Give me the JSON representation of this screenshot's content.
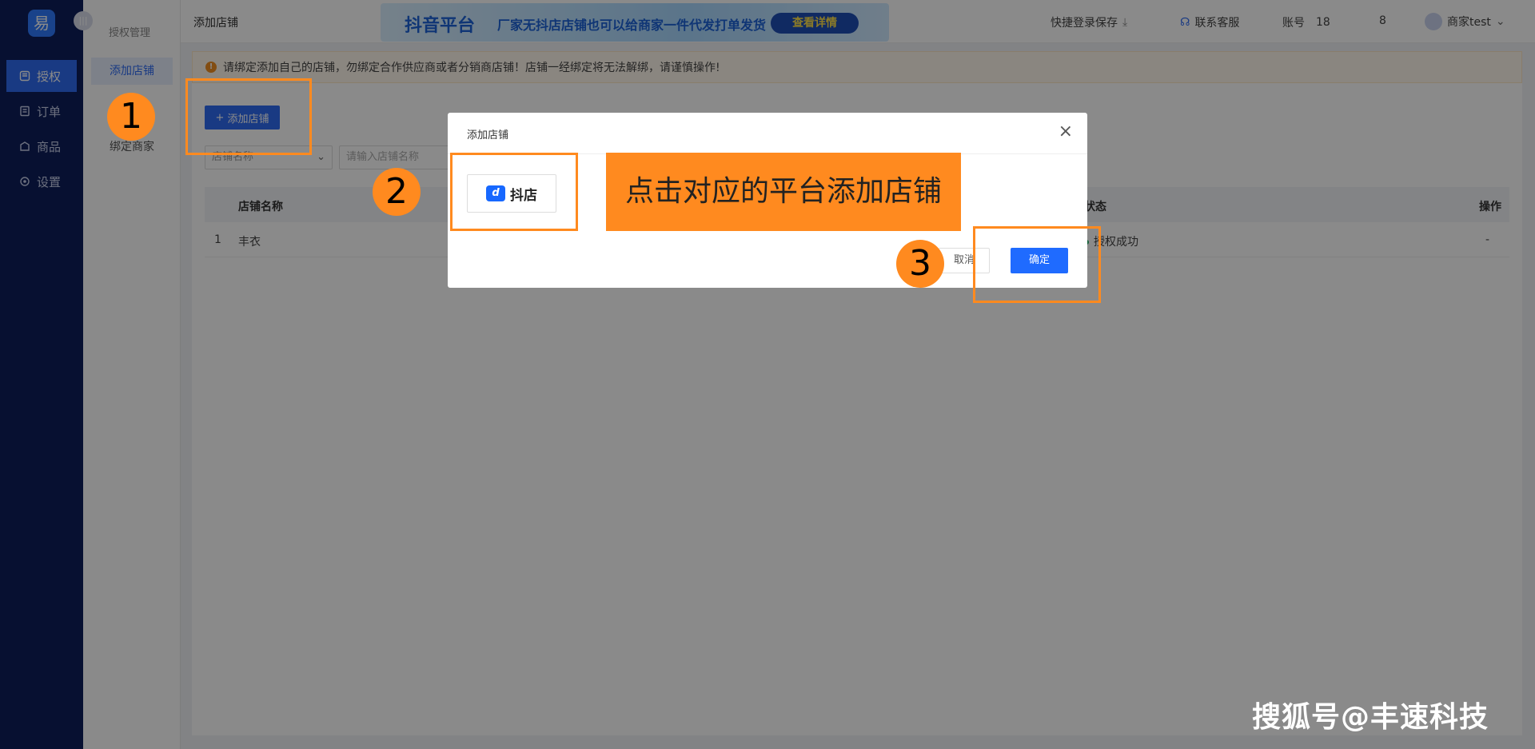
{
  "nav": {
    "logo": "易",
    "items": [
      {
        "label": "授权",
        "icon": "auth-icon",
        "active": true
      },
      {
        "label": "订单",
        "icon": "order-icon",
        "active": false
      },
      {
        "label": "商品",
        "icon": "product-icon",
        "active": false
      },
      {
        "label": "设置",
        "icon": "gear-icon",
        "active": false
      }
    ]
  },
  "subnav": {
    "title": "授权管理",
    "items": [
      {
        "label": "添加店铺",
        "active": true
      },
      {
        "label": "绑定商家",
        "active": false
      }
    ]
  },
  "header": {
    "breadcrumb": "添加店铺",
    "banner": {
      "brand": "抖音平台",
      "text": "厂家无抖店店铺也可以给商家一件代发打单发货",
      "button": "查看详情"
    },
    "quick_login": "快捷登录保存",
    "support": "联系客服",
    "account_label": "账号",
    "account_value": "18",
    "count": "8",
    "user": "商家test"
  },
  "main": {
    "notice": "请绑定添加自己的店铺，勿绑定合作供应商或者分销商店铺！店铺一经绑定将无法解绑，请谨慎操作!",
    "add_button": "添加店铺",
    "filter_select": "店铺名称",
    "search_placeholder": "请输入店铺名称",
    "table": {
      "headers": [
        "店铺名称",
        "状态",
        "操作"
      ],
      "rows": [
        {
          "index": "1",
          "name": "丰衣",
          "status": "授权成功",
          "action": "-"
        }
      ]
    }
  },
  "modal": {
    "title": "添加店铺",
    "platform": "抖店",
    "cancel": "取消",
    "confirm": "确定"
  },
  "annotations": {
    "step1": "1",
    "step2": "2",
    "step3": "3",
    "callout": "点击对应的平台添加店铺",
    "watermark": "搜狐号@丰速科技"
  },
  "colors": {
    "nav_bg": "#0e1f5b",
    "primary": "#2f6bf2",
    "annotation": "#ff8a1f"
  }
}
